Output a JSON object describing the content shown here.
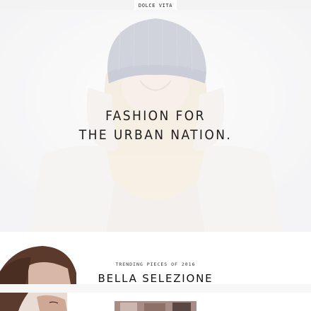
{
  "header": {
    "brand": "DOLCE VITA"
  },
  "hero": {
    "headline_line1": "FASHION FOR",
    "headline_line2": "THE URBAN NATION.",
    "image": "woman-in-knit-beanie-photo"
  },
  "collection": {
    "subtitle": "TRENDING PIECES OF 2016",
    "title": "BELLA SELEZIONE",
    "images": [
      "model-portrait-photo",
      "model-portrait-photo-2",
      "product-thumbnail-photo"
    ]
  },
  "colors": {
    "background": "#ffffff",
    "nav_strip": "#f3f3f3",
    "hero_bg": "#f6f6f7",
    "text": "#111111"
  }
}
